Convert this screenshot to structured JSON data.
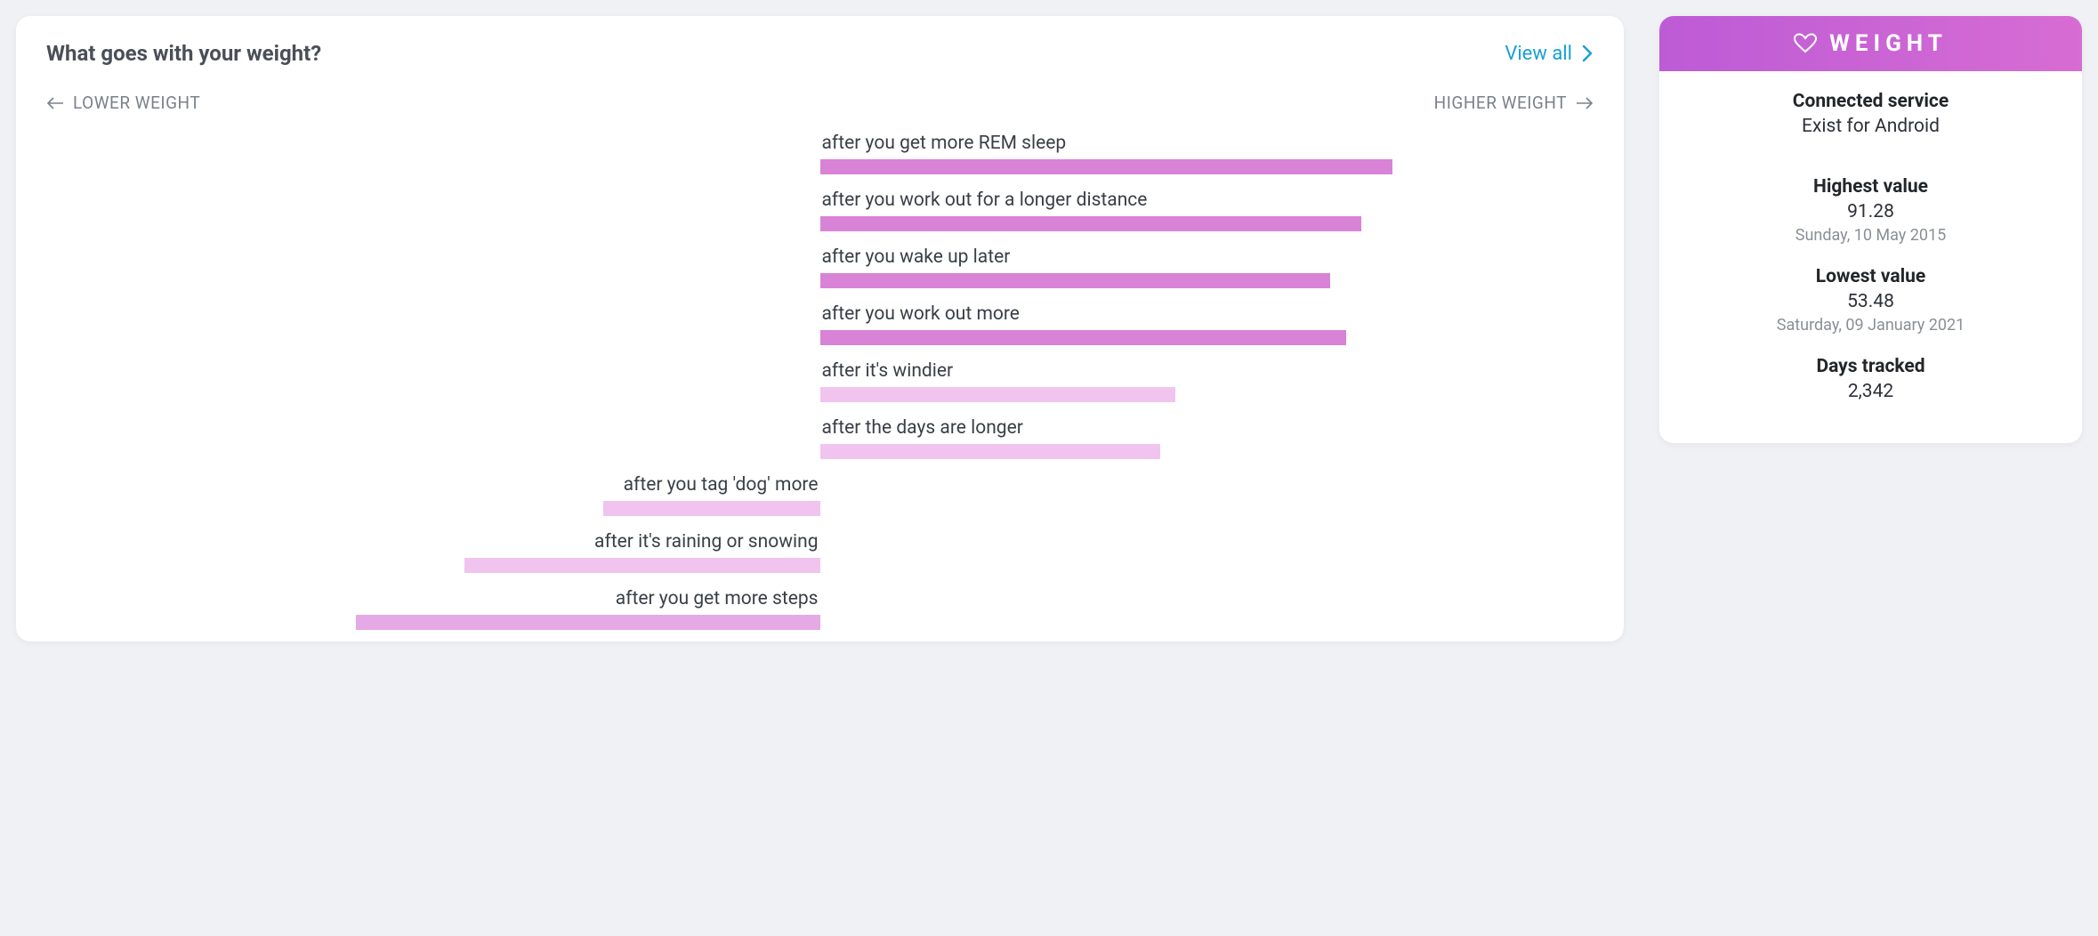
{
  "main": {
    "title": "What goes with your weight?",
    "view_all": "View all",
    "axis_lower": "LOWER WEIGHT",
    "axis_higher": "HIGHER WEIGHT"
  },
  "chart_data": {
    "type": "bar",
    "title": "What goes with your weight?",
    "xlabel": "",
    "ylabel": "",
    "axis_low_label": "LOWER WEIGHT",
    "axis_high_label": "HIGHER WEIGHT",
    "series": [
      {
        "name": "after you get more REM sleep",
        "value": 37,
        "direction": "higher",
        "strength": "strong"
      },
      {
        "name": "after you work out for a longer distance",
        "value": 35,
        "direction": "higher",
        "strength": "strong"
      },
      {
        "name": "after you wake up later",
        "value": 33,
        "direction": "higher",
        "strength": "strong"
      },
      {
        "name": "after you work out more",
        "value": 34,
        "direction": "higher",
        "strength": "strong"
      },
      {
        "name": "after it's windier",
        "value": 23,
        "direction": "higher",
        "strength": "light"
      },
      {
        "name": "after the days are longer",
        "value": 22,
        "direction": "higher",
        "strength": "light"
      },
      {
        "name": "after you tag 'dog' more",
        "value": -14,
        "direction": "lower",
        "strength": "light"
      },
      {
        "name": "after it's raining or snowing",
        "value": -23,
        "direction": "lower",
        "strength": "light"
      },
      {
        "name": "after you get more steps",
        "value": -30,
        "direction": "lower",
        "strength": "med"
      }
    ]
  },
  "side": {
    "header": "WEIGHT",
    "connected_label": "Connected service",
    "connected_value": "Exist for Android",
    "highest_label": "Highest value",
    "highest_value": "91.28",
    "highest_date": "Sunday, 10 May 2015",
    "lowest_label": "Lowest value",
    "lowest_value": "53.48",
    "lowest_date": "Saturday, 09 January 2021",
    "days_label": "Days tracked",
    "days_value": "2,342"
  }
}
